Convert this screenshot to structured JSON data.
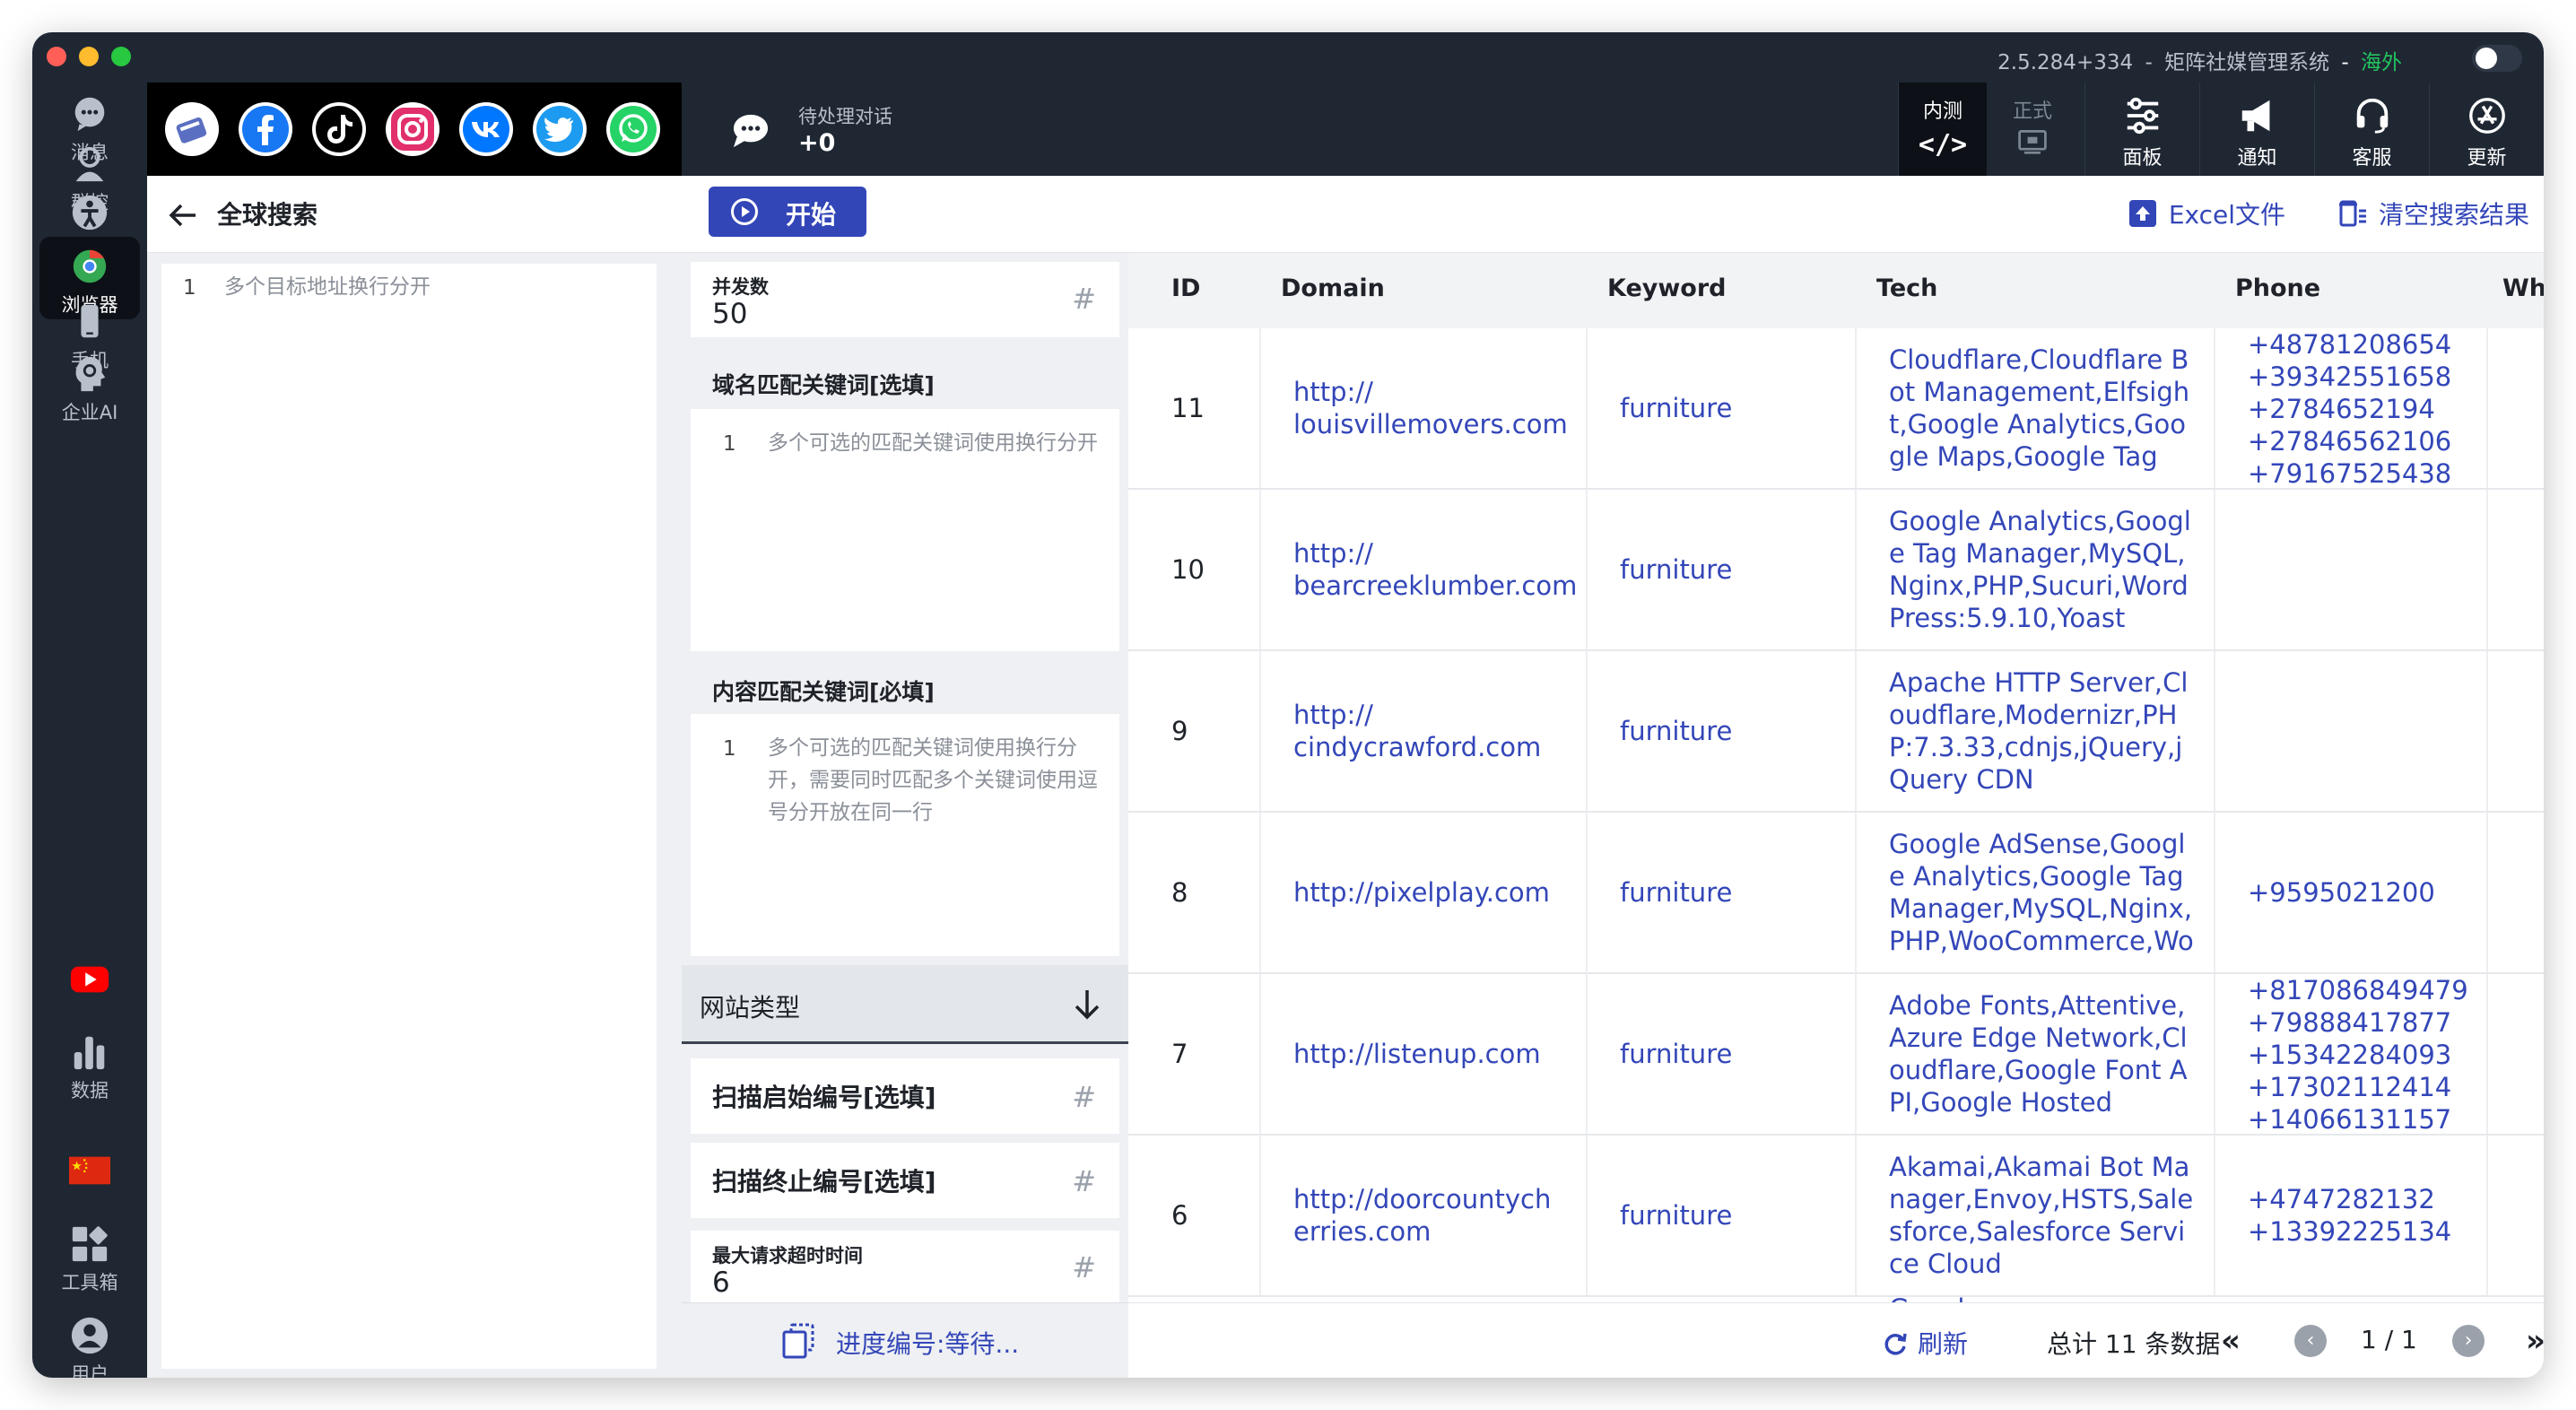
{
  "window": {
    "version": "2.5.284+334",
    "app_name": "矩阵社媒管理系统",
    "dash": "-",
    "region": "海外",
    "colors": {
      "accent": "#3346b8",
      "sidebar": "#1f2733",
      "region": "#22c55e"
    }
  },
  "leftnav": {
    "items": [
      {
        "label": "消息",
        "icon": "message-icon"
      },
      {
        "label": "群控",
        "icon": "group-control-icon"
      },
      {
        "label": "养号",
        "icon": "account-nurture-icon"
      },
      {
        "label": "浏览器",
        "icon": "browser-icon",
        "active": true
      },
      {
        "label": "手机",
        "icon": "phone-icon"
      },
      {
        "label": "企业AI",
        "icon": "ai-icon"
      },
      {
        "label": "",
        "icon": "youtube-icon"
      },
      {
        "label": "数据",
        "icon": "chart-icon"
      },
      {
        "label": "",
        "icon": "china-flag-icon"
      },
      {
        "label": "工具箱",
        "icon": "toolbox-icon"
      },
      {
        "label": "用户",
        "icon": "user-icon"
      }
    ]
  },
  "social": [
    "discord-icon",
    "facebook-icon",
    "tiktok-icon",
    "instagram-icon",
    "vk-icon",
    "twitter-icon",
    "whatsapp-icon"
  ],
  "toolbar": {
    "pending_label": "待处理对话",
    "pending_count": "+0",
    "mode_test": "内测",
    "mode_test_symbol": "</>",
    "mode_prod": "正式",
    "panel": "面板",
    "notify": "通知",
    "service": "客服",
    "update": "更新"
  },
  "search": {
    "title": "全球搜索",
    "address_line_no": "1",
    "address_placeholder": "多个目标地址换行分开",
    "start": "开始",
    "excel": "Excel文件",
    "clear": "清空搜索结果"
  },
  "form": {
    "concurrency_label": "并发数",
    "concurrency_value": "50",
    "hash": "#",
    "domain_kw_label": "域名匹配关键词[选填]",
    "domain_kw_line_no": "1",
    "domain_kw_placeholder": "多个可选的匹配关键词使用换行分开",
    "content_kw_label": "内容匹配关键词[必填]",
    "content_kw_line_no": "1",
    "content_kw_placeholder": "多个可选的匹配关键词使用换行分开，需要同时匹配多个关键词使用逗号分开放在同一行",
    "site_type_label": "网站类型",
    "scan_start_label": "扫描启始编号[选填]",
    "scan_end_label": "扫描终止编号[选填]",
    "timeout_label": "最大请求超时时间",
    "timeout_value": "6",
    "progress_label": "进度编号:等待..."
  },
  "table": {
    "headers": {
      "id": "ID",
      "domain": "Domain",
      "keyword": "Keyword",
      "tech": "Tech",
      "phone": "Phone",
      "whats": "Whats"
    },
    "rows": [
      {
        "id": "11",
        "domain": "http://\nlouisvillemovers.com",
        "keyword": "furniture",
        "tech": "Cloudflare,Cloudflare Bot Management,Elfsight,Google Analytics,Google Maps,Google Tag",
        "phone": "+48781208654\n+39342551658\n+2784652194\n+27846562106\n+79167525438"
      },
      {
        "id": "10",
        "domain": "http://\nbearcreeklumber.com",
        "keyword": "furniture",
        "tech": "Google Analytics,Google Tag Manager,MySQL,Nginx,PHP,Sucuri,WordPress:5.9.10,Yoast",
        "phone": ""
      },
      {
        "id": "9",
        "domain": "http://\ncindycrawford.com",
        "keyword": "furniture",
        "tech": "Apache HTTP Server,Cloudflare,Modernizr,PHP:7.3.33,cdnjs,jQuery,jQuery CDN",
        "phone": ""
      },
      {
        "id": "8",
        "domain": "http://pixelplay.com",
        "keyword": "furniture",
        "tech": "Google AdSense,Google Analytics,Google Tag Manager,MySQL,Nginx,PHP,WooCommerce,Wo",
        "phone": "+9595021200"
      },
      {
        "id": "7",
        "domain": "http://listenup.com",
        "keyword": "furniture",
        "tech": "Adobe Fonts,Attentive,Azure Edge Network,Cloudflare,Google Font API,Google Hosted",
        "phone": "+817086849479\n+79888417877\n+15342284093\n+17302112414\n+14066131157"
      },
      {
        "id": "6",
        "domain": "http://doorcountych\nerries.com",
        "keyword": "furniture",
        "tech": "Akamai,Akamai Bot Manager,Envoy,HSTS,Salesforce,Salesforce Service Cloud",
        "phone": "+4747282132\n+13392225134"
      }
    ],
    "partial_next": "Google"
  },
  "footer": {
    "refresh": "刷新",
    "total": "总计 11 条数据",
    "first": "«",
    "prev": "‹",
    "page": "1 / 1",
    "next": "›",
    "last": "»"
  }
}
